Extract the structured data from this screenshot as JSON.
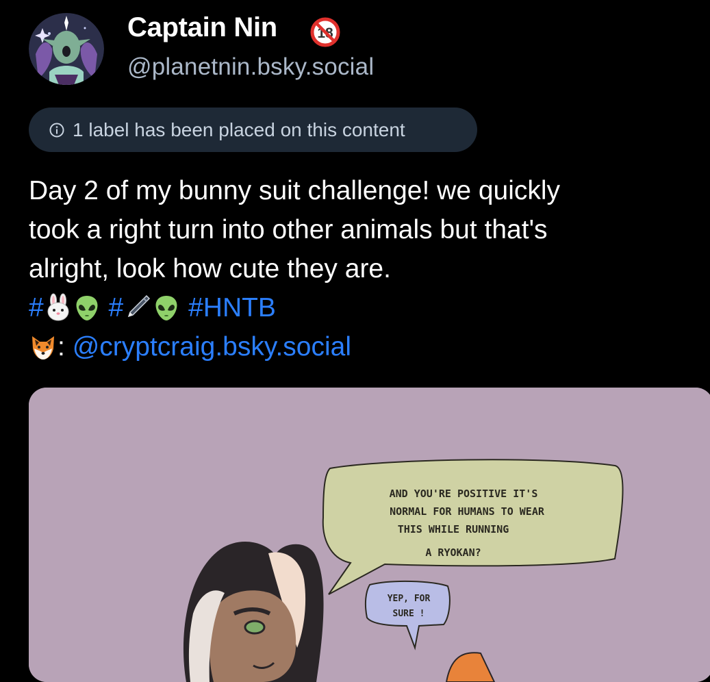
{
  "author": {
    "display_name": "Captain Nin",
    "handle": "@planetnin.bsky.social",
    "badge": "18"
  },
  "moderation": {
    "label_notice": "1 label has been placed on this content"
  },
  "post": {
    "line1": "Day 2 of my bunny suit challenge! we quickly",
    "line2": "took a right turn into other animals but that's",
    "line3": "alright, look how cute they are.",
    "hashtag_prefix_1": "#",
    "hashtag_prefix_2": "#",
    "hashtag_hntb": "#HNTB",
    "credit_separator": ":",
    "mention": "@cryptcraig.bsky.social"
  },
  "image": {
    "speech_bubble_1": [
      "AND YOU'RE POSITIVE IT'S",
      "NORMAL FOR HUMANS TO WEAR",
      "THIS WHILE RUNNING",
      "A RYOKAN?"
    ],
    "speech_bubble_2": [
      "YEP, FOR",
      "SURE !"
    ]
  },
  "icons": [
    "avatar",
    "adult-content-18-icon",
    "info-icon",
    "rabbit-face-emoji",
    "alien-emoji",
    "pen-emoji",
    "fox-face-emoji"
  ],
  "colors": {
    "background": "#000000",
    "link": "#2b7fff",
    "handle": "#abb8c9",
    "label_pill_bg": "#1e2936",
    "image_bg": "#b8a3b7"
  }
}
